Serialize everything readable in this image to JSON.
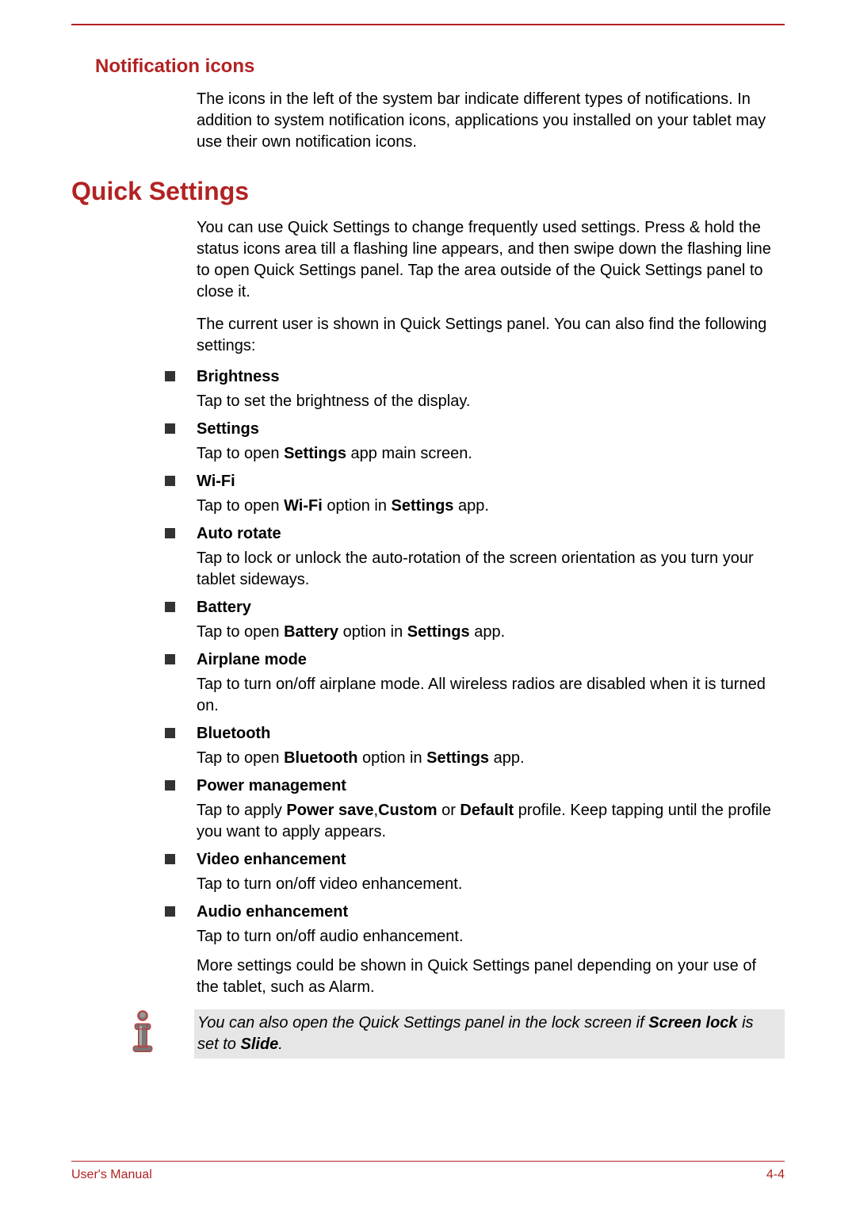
{
  "sections": {
    "notification_icons": {
      "title": "Notification icons",
      "para": "The icons in the left of the system bar indicate different types of notifications. In addition to system notification icons, applications you installed on your tablet may use their own notification icons."
    },
    "quick_settings": {
      "title": "Quick Settings",
      "para1": "You can use Quick Settings to change frequently used settings. Press & hold the status icons area till a flashing line appears, and then swipe down the flashing line to open Quick Settings panel. Tap the area outside of the Quick Settings panel to close it.",
      "para2": "The current user is shown in Quick Settings panel. You can also find the following settings:",
      "items": [
        {
          "title": "Brightness",
          "desc_parts": [
            {
              "t": "Tap to set the brightness of the display."
            }
          ]
        },
        {
          "title": "Settings",
          "desc_parts": [
            {
              "t": "Tap to open "
            },
            {
              "t": "Settings",
              "b": true
            },
            {
              "t": " app main screen."
            }
          ]
        },
        {
          "title": "Wi-Fi",
          "desc_parts": [
            {
              "t": "Tap to open "
            },
            {
              "t": "Wi-Fi",
              "b": true
            },
            {
              "t": " option in "
            },
            {
              "t": "Settings",
              "b": true
            },
            {
              "t": " app."
            }
          ]
        },
        {
          "title": "Auto rotate",
          "desc_parts": [
            {
              "t": "Tap to lock or unlock the auto-rotation of the screen orientation as you turn your tablet sideways."
            }
          ]
        },
        {
          "title": "Battery",
          "desc_parts": [
            {
              "t": "Tap to open "
            },
            {
              "t": "Battery",
              "b": true
            },
            {
              "t": " option in "
            },
            {
              "t": "Settings",
              "b": true
            },
            {
              "t": " app."
            }
          ]
        },
        {
          "title": "Airplane mode",
          "desc_parts": [
            {
              "t": "Tap to turn on/off airplane mode. All wireless radios are disabled when it is turned on."
            }
          ]
        },
        {
          "title": "Bluetooth",
          "desc_parts": [
            {
              "t": "Tap to open "
            },
            {
              "t": "Bluetooth",
              "b": true
            },
            {
              "t": " option in "
            },
            {
              "t": "Settings",
              "b": true
            },
            {
              "t": " app."
            }
          ]
        },
        {
          "title": "Power management",
          "desc_parts": [
            {
              "t": "Tap to apply "
            },
            {
              "t": "Power save",
              "b": true
            },
            {
              "t": ","
            },
            {
              "t": "Custom",
              "b": true
            },
            {
              "t": " or "
            },
            {
              "t": "Default",
              "b": true
            },
            {
              "t": " profile. Keep tapping until the profile you want to apply appears."
            }
          ]
        },
        {
          "title": "Video enhancement",
          "desc_parts": [
            {
              "t": "Tap to turn on/off video enhancement."
            }
          ]
        },
        {
          "title": "Audio enhancement",
          "desc_parts": [
            {
              "t": "Tap to turn on/off audio enhancement."
            }
          ]
        }
      ],
      "para3": "More settings could be shown in Quick Settings panel depending on your use of the tablet, such as Alarm.",
      "note_parts": [
        {
          "t": "You can also open the Quick Settings panel in the lock screen if "
        },
        {
          "t": "Screen lock",
          "ib": true
        },
        {
          "t": " is set to "
        },
        {
          "t": "Slide",
          "ib": true
        },
        {
          "t": "."
        }
      ]
    }
  },
  "footer": {
    "left": "User's Manual",
    "right": "4-4"
  }
}
